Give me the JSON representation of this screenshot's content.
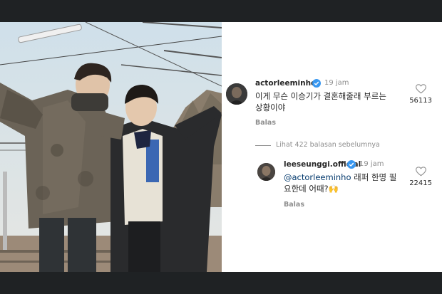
{
  "photo": {
    "alt_icon": "photo-two-men"
  },
  "comments": [
    {
      "username": "actorleeminho",
      "time": "19 jam",
      "text_line1": "이게 무슨 이승기가 결혼해줄래 부르는",
      "text_line2": "상황이야",
      "reply_label": "Balas",
      "likes": "56113"
    }
  ],
  "view_replies": "Lihat 422 balasan sebelumnya",
  "reply": {
    "username": "leeseunggi.official",
    "time": "19 jam",
    "mention": "@actorleeminho",
    "text_line1_rest": " 래퍼 한명 필",
    "text_line2": "요한데 어때?🙌",
    "reply_label": "Balas",
    "likes": "22415"
  },
  "colors": {
    "verified": "#3897f0",
    "background": "#1f2224",
    "text": "#262626",
    "muted": "#8e8e8e"
  }
}
